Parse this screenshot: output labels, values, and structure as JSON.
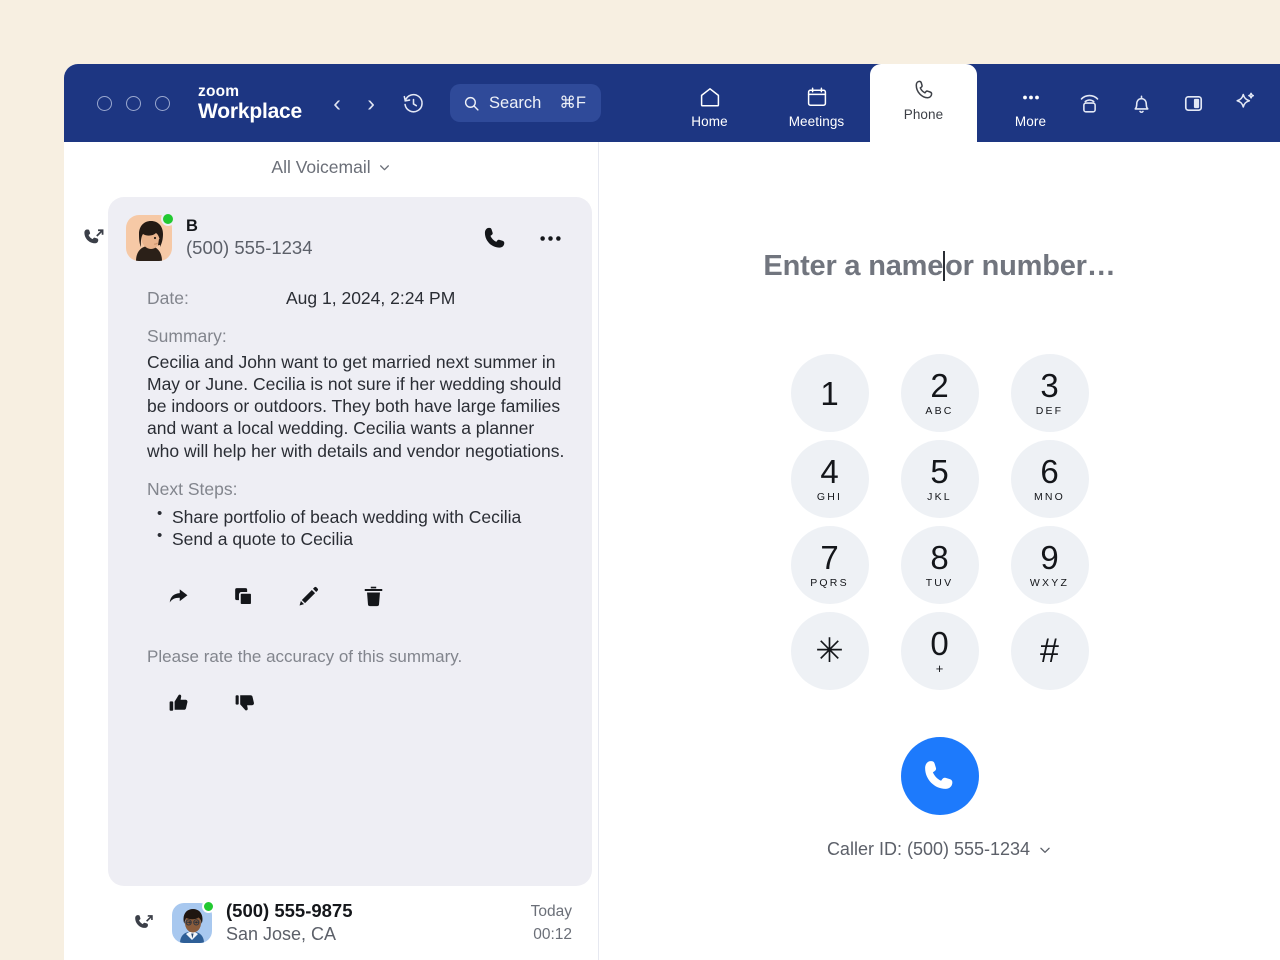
{
  "titlebar": {
    "brand_top": "zoom",
    "brand_bottom": "Workplace",
    "back_arrow": "‹",
    "forward_arrow": "›",
    "history_icon": "history-icon",
    "search": {
      "label": "Search",
      "shortcut": "⌘F",
      "icon": "search-icon"
    },
    "tabs": [
      {
        "label": "Home",
        "icon": "home-icon",
        "active": false
      },
      {
        "label": "Meetings",
        "icon": "calendar-icon",
        "active": false
      },
      {
        "label": "Phone",
        "icon": "phone-icon",
        "active": true
      },
      {
        "label": "More",
        "icon": "ellipsis-icon",
        "active": false
      }
    ],
    "right_icons": [
      {
        "name": "screen-share-icon"
      },
      {
        "name": "notification-bell-icon"
      },
      {
        "name": "side-panel-icon"
      },
      {
        "name": "ai-sparkle-icon"
      }
    ]
  },
  "voicemail": {
    "filter_label": "All Voicemail",
    "filter_chevron": "⌄",
    "card": {
      "direction_icon": "outgoing-call-icon",
      "avatar": "woman-avatar",
      "presence": "available",
      "name": "B",
      "number": "(500) 555-1234",
      "call_icon": "phone-icon",
      "more_icon": "ellipsis-icon",
      "date_label": "Date:",
      "date_value": "Aug 1, 2024, 2:24 PM",
      "summary_label": "Summary:",
      "summary_text": "Cecilia and John want to get married next summer in May or June. Cecilia is not sure if her wedding should be indoors or outdoors. They both have large families and want a local wedding. Cecilia wants a planner who will help her with details and vendor negotiations.",
      "next_steps_label": "Next Steps:",
      "next_steps": [
        "Share portfolio of beach wedding with Cecilia",
        "Send a quote to Cecilia"
      ],
      "tools": [
        {
          "name": "share-icon"
        },
        {
          "name": "copy-icon"
        },
        {
          "name": "edit-icon"
        },
        {
          "name": "delete-icon"
        }
      ],
      "rating_prompt": "Please rate the accuracy of this summary.",
      "rating": [
        {
          "name": "thumbs-up-icon"
        },
        {
          "name": "thumbs-down-icon"
        }
      ]
    },
    "list_item": {
      "direction_icon": "outgoing-call-icon",
      "avatar": "man-avatar",
      "presence": "available",
      "number": "(500) 555-9875",
      "location": "San Jose, CA",
      "day": "Today",
      "duration": "00:12"
    }
  },
  "dialer": {
    "placeholder_before": "Enter a name",
    "placeholder_after": " or number…",
    "keys": [
      {
        "digit": "1",
        "letters": ""
      },
      {
        "digit": "2",
        "letters": "ABC"
      },
      {
        "digit": "3",
        "letters": "DEF"
      },
      {
        "digit": "4",
        "letters": "GHI"
      },
      {
        "digit": "5",
        "letters": "JKL"
      },
      {
        "digit": "6",
        "letters": "MNO"
      },
      {
        "digit": "7",
        "letters": "PQRS"
      },
      {
        "digit": "8",
        "letters": "TUV"
      },
      {
        "digit": "9",
        "letters": "WXYZ"
      },
      {
        "digit": "✳",
        "letters": ""
      },
      {
        "digit": "0",
        "letters": "+"
      },
      {
        "digit": "#",
        "letters": ""
      }
    ],
    "call_button_icon": "phone-icon",
    "caller_id_label": "Caller ID: (500) 555-1234",
    "caller_id_chevron": "⌄",
    "accent_color": "#1d7afc"
  }
}
